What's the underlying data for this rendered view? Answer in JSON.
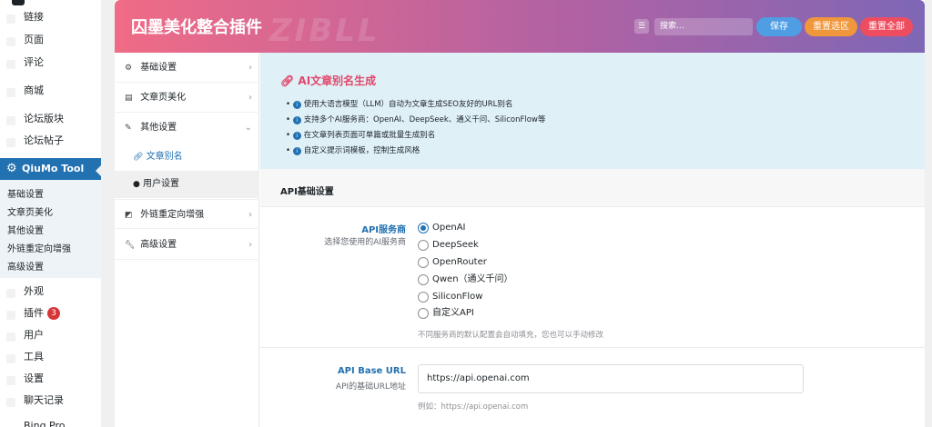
{
  "wp_sidebar": {
    "items_top": [
      {
        "label": "链接",
        "name": "wp-menu-links"
      },
      {
        "label": "页面",
        "name": "wp-menu-pages"
      },
      {
        "label": "评论",
        "name": "wp-menu-comments"
      },
      {
        "label": "商城",
        "name": "wp-menu-shop"
      },
      {
        "label": "论坛版块",
        "name": "wp-menu-forum-boards"
      },
      {
        "label": "论坛帖子",
        "name": "wp-menu-forum-posts"
      }
    ],
    "active": "QiuMo Tool",
    "submenu": [
      "基础设置",
      "文章页美化",
      "其他设置",
      "外链重定向增强",
      "高级设置"
    ],
    "items_bottom": [
      "外观",
      "插件",
      "用户",
      "工具",
      "设置",
      "聊天记录",
      "Bing Pro"
    ],
    "plugins_badge": "3"
  },
  "header": {
    "title": "囚墨美化整合插件",
    "watermark": "ZIBLL",
    "search_placeholder": "搜索...",
    "save_label": "保存",
    "reset_section_label": "重置选区",
    "reset_all_label": "重置全部",
    "colors": {
      "save": "#4f9ee3",
      "reset_section": "#f0973b",
      "reset_all": "#ee4d5f"
    }
  },
  "nav": {
    "items": [
      {
        "label": "基础设置",
        "icon": "gear-icon"
      },
      {
        "label": "文章页美化",
        "icon": "document-icon"
      },
      {
        "label": "其他设置",
        "icon": "pin-icon"
      },
      {
        "label": "外链重定向增强",
        "icon": "external-link-icon"
      },
      {
        "label": "高级设置",
        "icon": "wrench-icon"
      }
    ],
    "subitems": [
      {
        "label": "文章别名",
        "icon": "link-icon",
        "active": true
      },
      {
        "label": "用户设置",
        "icon": "user-icon",
        "active": false
      }
    ]
  },
  "info": {
    "title": "AI文章别名生成",
    "bullets": [
      "使用大语言模型（LLM）自动为文章生成SEO友好的URL别名",
      "支持多个AI服务商：OpenAI、DeepSeek、通义千问、SiliconFlow等",
      "在文章列表页面可单篇或批量生成别名",
      "自定义提示词模板，控制生成风格"
    ]
  },
  "section": {
    "title": "API基础设置",
    "provider": {
      "label": "API服务商",
      "desc": "选择您使用的AI服务商",
      "options": [
        "OpenAI",
        "DeepSeek",
        "OpenRouter",
        "Qwen（通义千问）",
        "SiliconFlow",
        "自定义API"
      ],
      "selected": "OpenAI",
      "hint": "不同服务商的默认配置会自动填充，您也可以手动修改"
    },
    "base_url": {
      "label": "API Base URL",
      "desc": "API的基础URL地址",
      "value": "https://api.openai.com",
      "hint": "例如：https://api.openai.com"
    }
  }
}
